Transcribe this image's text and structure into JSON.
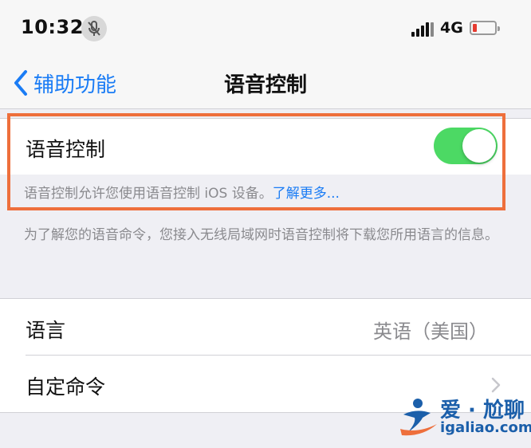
{
  "status_bar": {
    "time": "10:32",
    "network": "4G"
  },
  "nav": {
    "back_label": "辅助功能",
    "title": "语音控制"
  },
  "voice_control": {
    "label": "语音控制",
    "enabled": true,
    "description": "语音控制允许您使用语音控制 iOS 设备。",
    "learn_more": "了解更多..."
  },
  "download_note": "为了解您的语音命令，您接入无线局域网时语音控制将下载您所用语言的信息。",
  "settings": {
    "language_label": "语言",
    "language_value": "英语（美国）",
    "custom_commands_label": "自定命令"
  },
  "watermark": {
    "text": "爱 · 尬聊",
    "url": "igaliao.com"
  },
  "colors": {
    "accent": "#1a7cf5",
    "toggle_on": "#4cd964",
    "highlight": "#ee6f3c"
  }
}
